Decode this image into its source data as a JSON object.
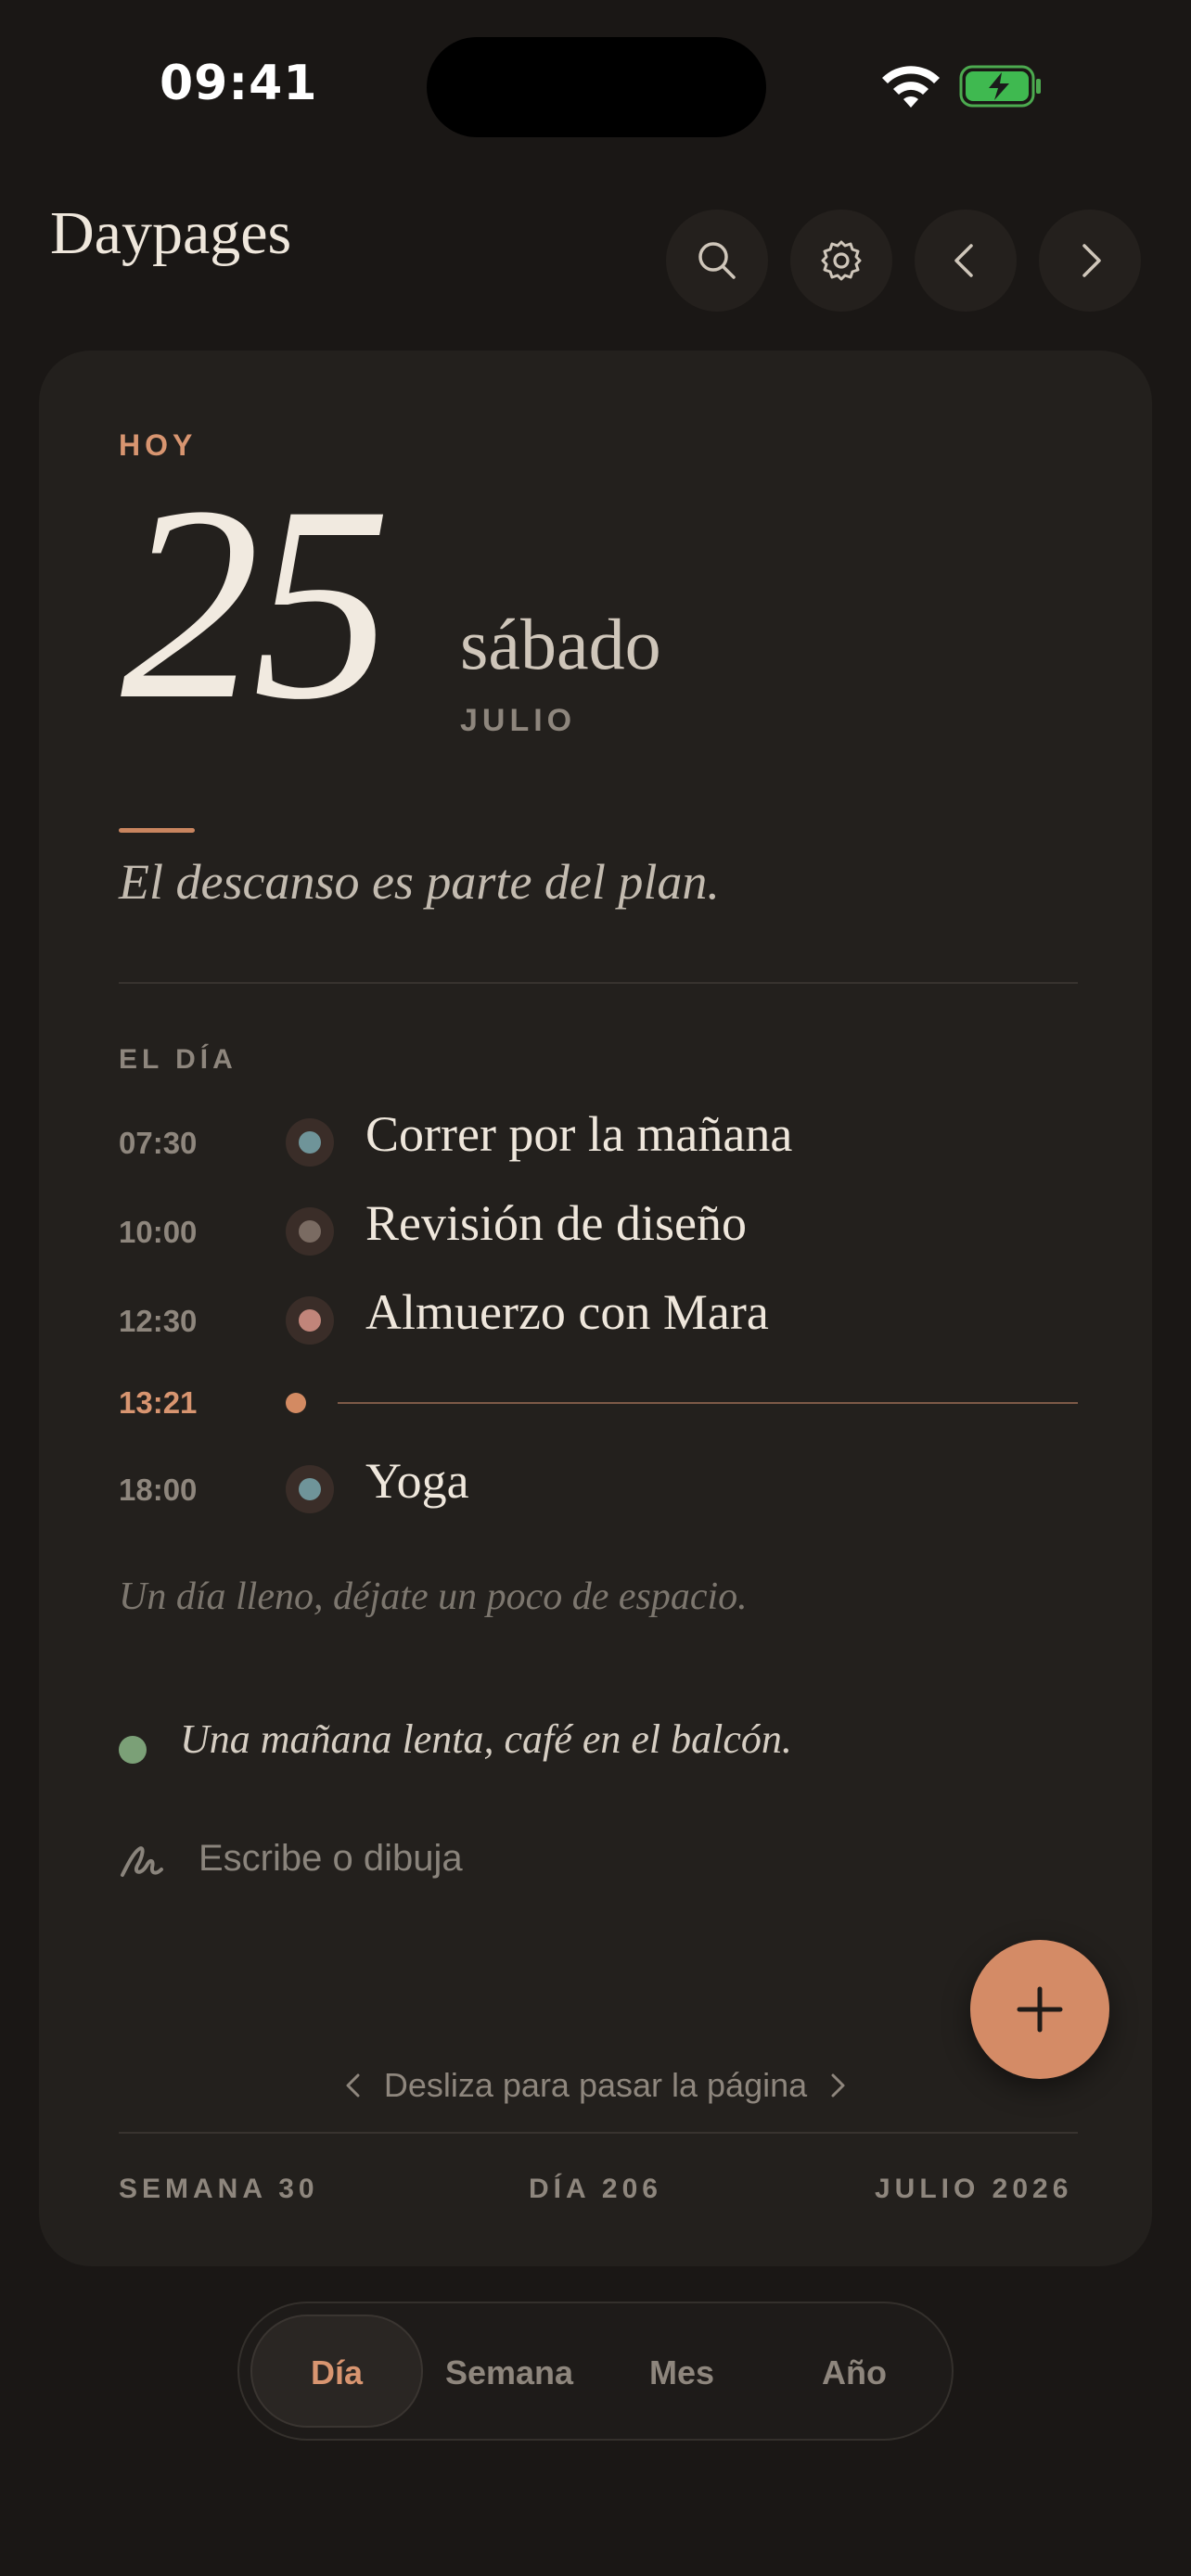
{
  "status_bar": {
    "time": "09:41",
    "icons": [
      "wifi-icon",
      "battery-charging-icon"
    ]
  },
  "header": {
    "title": "Daypages",
    "buttons": [
      "search-icon",
      "gear-icon",
      "chevron-left-icon",
      "chevron-right-icon"
    ]
  },
  "day": {
    "today_label": "HOY",
    "number": "25",
    "weekday": "sábado",
    "month": "JULIO",
    "quote": "El descanso es parte del plan."
  },
  "schedule": {
    "section_label": "EL DÍA",
    "events": [
      {
        "time": "07:30",
        "title": "Correr por la mañana",
        "color": "#6f9499"
      },
      {
        "time": "10:00",
        "title": "Revisión de diseño",
        "color": "#7a6b62"
      },
      {
        "time": "12:30",
        "title": "Almuerzo con Mara",
        "color": "#c1857a"
      },
      {
        "time": "18:00",
        "title": "Yoga",
        "color": "#6f9499"
      }
    ],
    "now": "13:21",
    "hint": "Un día lleno, déjate un poco de espacio."
  },
  "note": {
    "text": "Una mañana lenta, café en el balcón.",
    "color": "#7ba077"
  },
  "compose": {
    "prompt": "Escribe o dibuja"
  },
  "swipe_hint": "Desliza para pasar la página",
  "footer": {
    "week": "SEMANA 30",
    "day_of_year": "DÍA 206",
    "month_year": "JULIO 2026"
  },
  "tabs": {
    "items": [
      "Día",
      "Semana",
      "Mes",
      "Año"
    ],
    "active": "Día"
  },
  "colors": {
    "accent": "#d48b66",
    "background": "#1a1715",
    "card": "#23201d"
  }
}
